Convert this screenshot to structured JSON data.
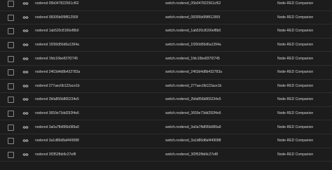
{
  "table": {
    "rows": [
      {
        "device_id": "nodered 05b047822561cf62",
        "entity_id": "switch.nodered_05b047822561cf62",
        "integration": "Node-RED Companion",
        "icon": "toggle-switch-icon"
      },
      {
        "device_id": "nodered 08305b6f9f812909",
        "entity_id": "switch.nodered_08305b6f9f812909",
        "integration": "Node-RED Companion",
        "icon": "toggle-switch-icon"
      },
      {
        "device_id": "nodered 1ab520c8166ef8b0",
        "entity_id": "switch.nodered_1ab520c8166ef8b0",
        "integration": "Node-RED Companion",
        "icon": "toggle-switch-icon"
      },
      {
        "device_id": "nodered 1f260d56d6a1394a",
        "entity_id": "switch.nodered_1f260d56d6a1394a",
        "integration": "Node-RED Companion",
        "icon": "toggle-switch-icon"
      },
      {
        "device_id": "nodered 1fdc16be837f2745",
        "entity_id": "switch.nodered_1fdc16be837f2745",
        "integration": "Node-RED Companion",
        "icon": "toggle-switch-icon"
      },
      {
        "device_id": "nodered 2463d4d8b432783a",
        "entity_id": "switch.nodered_2463d4d8b432783a",
        "integration": "Node-RED Companion",
        "icon": "toggle-switch-icon"
      },
      {
        "device_id": "nodered 277aec0b122ace1b",
        "entity_id": "switch.nodered_277aec0b122ace1b",
        "integration": "Node-RED Companion",
        "icon": "toggle-switch-icon"
      },
      {
        "device_id": "nodered 2bfa856b865234e5",
        "entity_id": "switch.nodered_2bfa856b865234e5",
        "integration": "Node-RED Companion",
        "icon": "toggle-switch-icon"
      },
      {
        "device_id": "nodered 3659e73dd292f4e6",
        "entity_id": "switch.nodered_3659e73dd292f4e6",
        "integration": "Node-RED Companion",
        "icon": "toggle-switch-icon"
      },
      {
        "device_id": "nodered 3a0a7fb895b089a9",
        "entity_id": "switch.nodered_3a0a7fb895b089a9",
        "integration": "Node-RED Companion",
        "icon": "toggle-switch-icon"
      },
      {
        "device_id": "nodered 3a1d86d8af449088",
        "entity_id": "switch.nodered_3a1d86d8af449088",
        "integration": "Node-RED Companion",
        "icon": "toggle-switch-icon"
      },
      {
        "device_id": "nodered 3f2f52fbb9c27ef8",
        "entity_id": "switch.nodered_3f2f52fbb9c27ef8",
        "integration": "Node-RED Companion",
        "icon": "toggle-switch-icon"
      }
    ]
  },
  "colors": {
    "background": "#1c1c1c",
    "text": "#d4d4d4",
    "divider": "#2d2d2d",
    "checkbox_border": "#8a8a8a"
  }
}
